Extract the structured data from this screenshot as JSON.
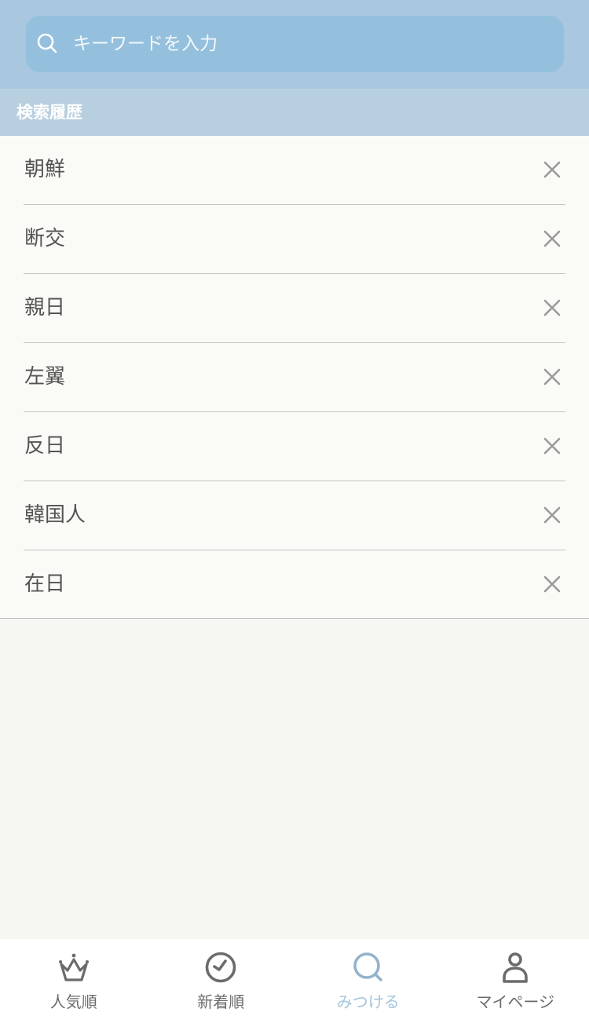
{
  "search": {
    "placeholder": "キーワードを入力",
    "value": ""
  },
  "history": {
    "header": "検索履歴",
    "items": [
      {
        "label": "朝鮮"
      },
      {
        "label": "断交"
      },
      {
        "label": "親日"
      },
      {
        "label": "左翼"
      },
      {
        "label": "反日"
      },
      {
        "label": "韓国人"
      },
      {
        "label": "在日"
      }
    ],
    "delete_icon": "close-icon"
  },
  "tabbar": {
    "active_tab": "みつける",
    "tabs": [
      {
        "label": "人気順",
        "icon": "crown-icon"
      },
      {
        "label": "新着順",
        "icon": "clock-icon"
      },
      {
        "label": "みつける",
        "icon": "search-icon"
      },
      {
        "label": "マイページ",
        "icon": "user-icon"
      }
    ]
  },
  "colors": {
    "header_bg": "#a9c7df",
    "search_bg": "#94c0dd",
    "section_bg": "#b8cfdf",
    "active_tab": "#a6c4db",
    "inactive_tab": "#6b6b6b"
  }
}
